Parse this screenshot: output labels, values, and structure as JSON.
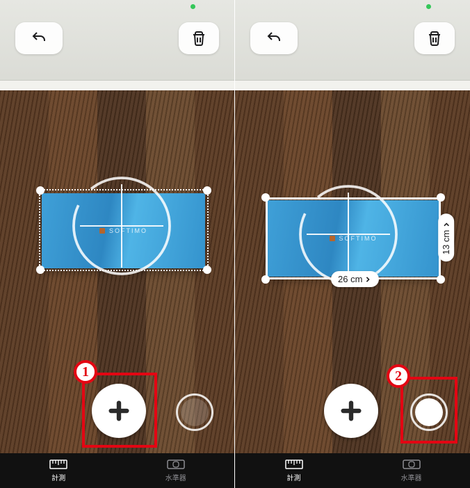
{
  "brand_text": "SOFTIMO",
  "measurements": {
    "width": "26 cm",
    "height": "13 cm"
  },
  "annotations": {
    "left": "1",
    "right": "2"
  },
  "tabs": {
    "measure": "計測",
    "level": "水準器"
  },
  "icons": {
    "undo": "undo-icon",
    "trash": "trash-icon",
    "add": "plus-icon",
    "shutter": "shutter-icon",
    "ruler": "ruler-icon",
    "level": "level-icon",
    "chevron": "chevron-right-icon"
  }
}
